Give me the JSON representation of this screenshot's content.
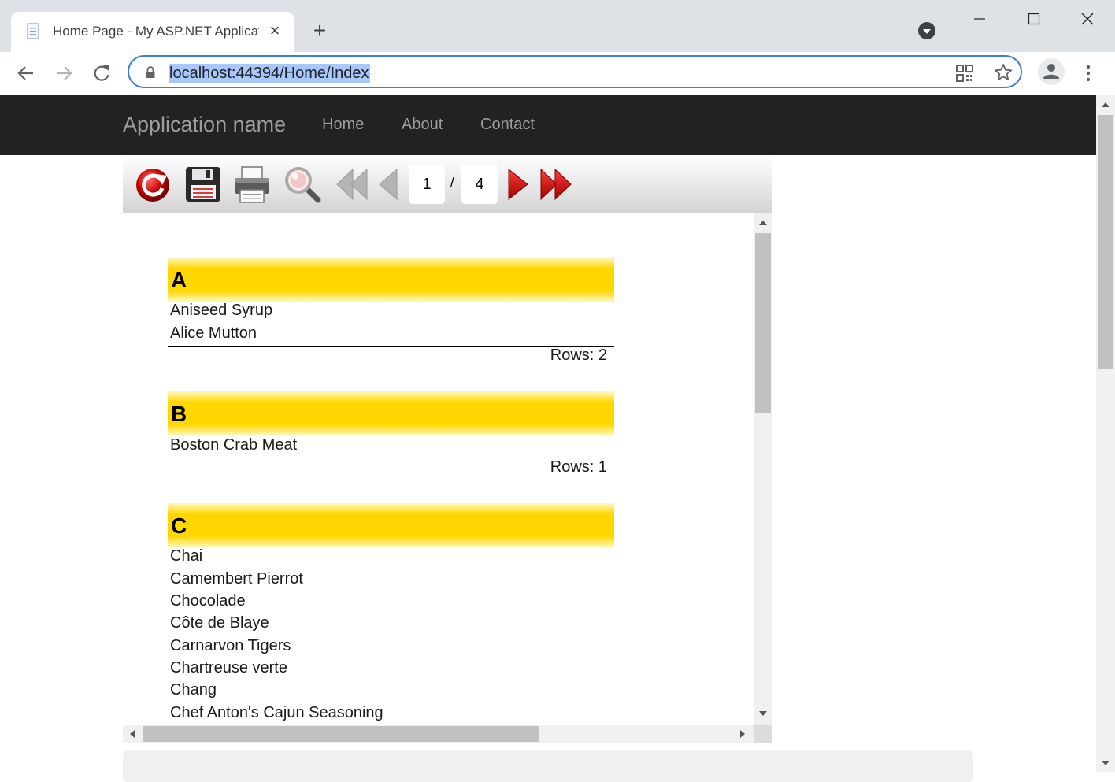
{
  "browser": {
    "tab_title": "Home Page - My ASP.NET Application",
    "url": "localhost:44394/Home/Index"
  },
  "navbar": {
    "brand": "Application name",
    "links": [
      "Home",
      "About",
      "Contact"
    ]
  },
  "report_toolbar": {
    "current_page": "1",
    "separator": "/",
    "total_pages": "4"
  },
  "report": {
    "groups": [
      {
        "letter": "A",
        "items": [
          "Aniseed Syrup",
          "Alice Mutton"
        ],
        "rows_label": "Rows: 2"
      },
      {
        "letter": "B",
        "items": [
          "Boston Crab Meat"
        ],
        "rows_label": "Rows: 1"
      },
      {
        "letter": "C",
        "items": [
          "Chai",
          "Camembert Pierrot",
          "Chocolade",
          "Côte de Blaye",
          "Carnarvon Tigers",
          "Chartreuse verte",
          "Chang",
          "Chef Anton's Cajun Seasoning"
        ]
      }
    ]
  },
  "colors": {
    "group_header": "#ffd700",
    "navbar": "#222222",
    "accent": "#3b7ddd"
  }
}
